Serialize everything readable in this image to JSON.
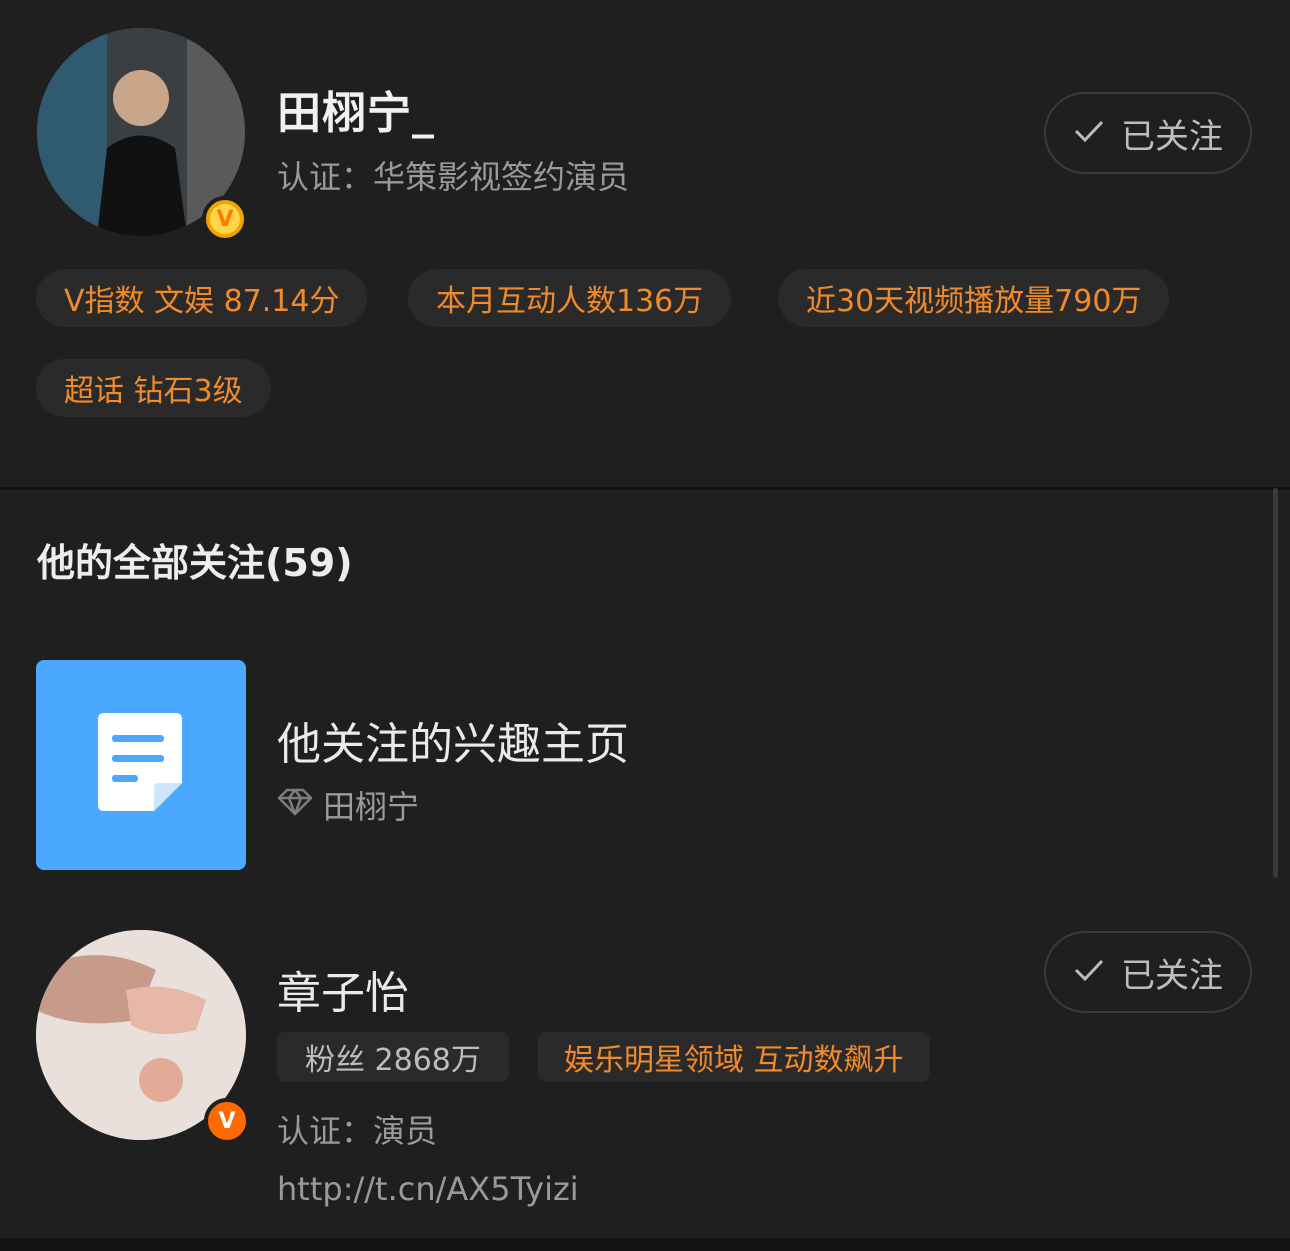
{
  "profile": {
    "name": "田栩宁_",
    "verification": "认证：华策影视签约演员",
    "follow_button": "已关注",
    "stats_chips": [
      "V指数 文娱 87.14分",
      "本月互动人数136万",
      "近30天视频播放量790万",
      "超话 钻石3级"
    ]
  },
  "following": {
    "title": "他的全部关注(59)",
    "items": [
      {
        "title": "他关注的兴趣主页",
        "subtitle": "田栩宁",
        "icon": "document-icon"
      },
      {
        "name": "章子怡",
        "follow_button": "已关注",
        "fans": "粉丝 2868万",
        "tag": "娱乐明星领域 互动数飙升",
        "verification": "认证：演员",
        "link": "http://t.cn/AX5Tyizi"
      }
    ]
  },
  "colors": {
    "background": "#1f1f1f",
    "accent_orange": "#f08a2a",
    "tile_blue": "#4aa9ff"
  }
}
